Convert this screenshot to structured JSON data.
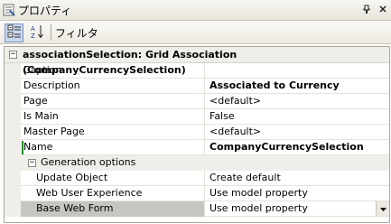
{
  "window": {
    "title": "プロパティ",
    "pin_icon": "pin-icon",
    "close_icon": "close-icon"
  },
  "toolbar": {
    "filter_label": "フィルタ"
  },
  "grid": {
    "header": "associationSelection: Grid Association (CompanyCurrencySelection)",
    "properties": [
      {
        "name": "Caption",
        "value": "",
        "bold": false
      },
      {
        "name": "Description",
        "value": "Associated to Currency",
        "bold": true
      },
      {
        "name": "Page",
        "value": "<default>",
        "bold": false
      },
      {
        "name": "Is Main",
        "value": "False",
        "bold": false
      },
      {
        "name": "Master Page",
        "value": "<default>",
        "bold": false
      },
      {
        "name": "Name",
        "value": "CompanyCurrencySelection",
        "bold": true
      }
    ],
    "category": {
      "label": "Generation options",
      "properties": [
        {
          "name": "Update Object",
          "value": "Create default"
        },
        {
          "name": "Web User Experience",
          "value": "Use model property"
        },
        {
          "name": "Base Web Form",
          "value": "Use model property"
        }
      ]
    }
  }
}
